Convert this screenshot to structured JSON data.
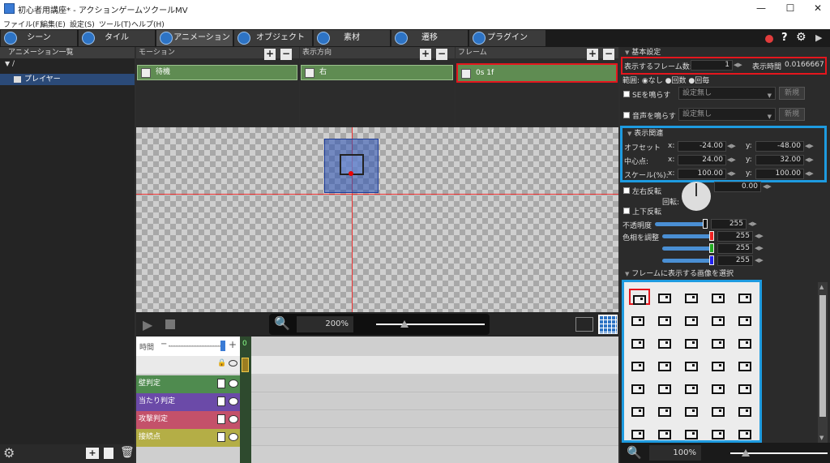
{
  "window": {
    "title": "初心者用講座* - アクションゲームツクールMV",
    "min": "—",
    "max": "☐",
    "close": "✕"
  },
  "menu": [
    "ファイル(F)",
    "編集(E)",
    "設定(S)",
    "ツール(T)",
    "ヘルプ(H)"
  ],
  "tabs": [
    "シーン",
    "タイル",
    "アニメーション",
    "オブジェクト",
    "素材",
    "遷移",
    "プラグイン"
  ],
  "top_right_icons": [
    "record-icon",
    "help-icon",
    "gear-icon",
    "play-icon"
  ],
  "sidebar": {
    "header": "アニメーション一覧",
    "root": "/",
    "item": "プレイヤー"
  },
  "columns": {
    "motion": {
      "header": "モーション",
      "item": "待機"
    },
    "direction": {
      "header": "表示方向",
      "item": "右"
    },
    "frame": {
      "header": "フレーム",
      "item": "0s 1f"
    }
  },
  "zoom": {
    "canvas": "200%",
    "frames": "100%"
  },
  "timeline": {
    "label": "時間",
    "frame_number": "0",
    "tracks": [
      "壁判定",
      "当たり判定",
      "攻撃判定",
      "接続点"
    ],
    "track_colors": [
      "#4f8b4f",
      "#6b4aa8",
      "#c4516a",
      "#b4ae46"
    ]
  },
  "basic": {
    "header": "基本設定",
    "frame_count_label": "表示するフレーム数:",
    "frame_count": "1",
    "time_label": "表示時間",
    "time_value": "0.0166667",
    "range_label": "範囲:",
    "range_none": "なし",
    "range_b": "回数",
    "range_c": "回毎",
    "se_label": "SEを鳴らす",
    "se_value": "設定無し",
    "se_new": "新規",
    "voice_label": "音声を鳴らす",
    "voice_value": "設定無し",
    "voice_new": "新規"
  },
  "display": {
    "header": "表示関連",
    "offset_label": "オフセット",
    "center_label": "中心点:",
    "scale_label": "スケール(%):",
    "x": "x:",
    "y": "y:",
    "offset_x": "-24.00",
    "offset_y": "-48.00",
    "center_x": "24.00",
    "center_y": "32.00",
    "scale_x": "100.00",
    "scale_y": "100.00",
    "flip_h": "左右反転",
    "rotate_label": "回転:",
    "rotate_value": "0.00",
    "flip_v": "上下反転",
    "opacity_label": "不透明度",
    "opacity": "255",
    "hue_label": "色相を調整",
    "hue_r": "255",
    "hue_g": "255",
    "hue_b": "255"
  },
  "select": {
    "header": "フレームに表示する画像を選択"
  },
  "colors": {
    "accent": "#2d73c4",
    "highlight_red": "#e5161d",
    "highlight_blue": "#1e9be0",
    "item_green": "#5f8c52"
  }
}
